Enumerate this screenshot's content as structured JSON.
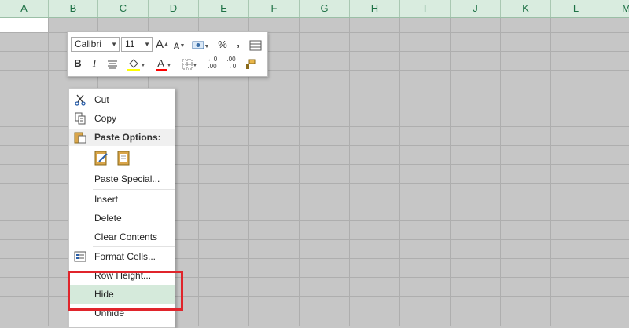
{
  "columns": [
    "A",
    "B",
    "C",
    "D",
    "E",
    "F",
    "G",
    "H",
    "I",
    "J",
    "K",
    "L",
    "M"
  ],
  "mini_toolbar": {
    "font_name": "Calibri",
    "font_size": "11",
    "grow_font": "A",
    "shrink_font": "A",
    "percent": "%",
    "comma": ",",
    "bold": "B",
    "italic": "I",
    "font_color": "A",
    "dec_increase": ".00",
    "dec_decrease": ".00",
    "highlight_color": "#ffff00",
    "font_color_bar": "#ff0000"
  },
  "context_menu": {
    "items": {
      "cut": "Cut",
      "copy": "Copy",
      "paste_options": "Paste Options:",
      "paste_special": "Paste Special...",
      "insert": "Insert",
      "delete": "Delete",
      "clear_contents": "Clear Contents",
      "format_cells": "Format Cells...",
      "row_height": "Row Height...",
      "hide": "Hide",
      "unhide": "Unhide"
    }
  },
  "colors": {
    "accent": "#1e7145",
    "highlight_border": "#e0242b",
    "hover": "#d5eadb"
  }
}
